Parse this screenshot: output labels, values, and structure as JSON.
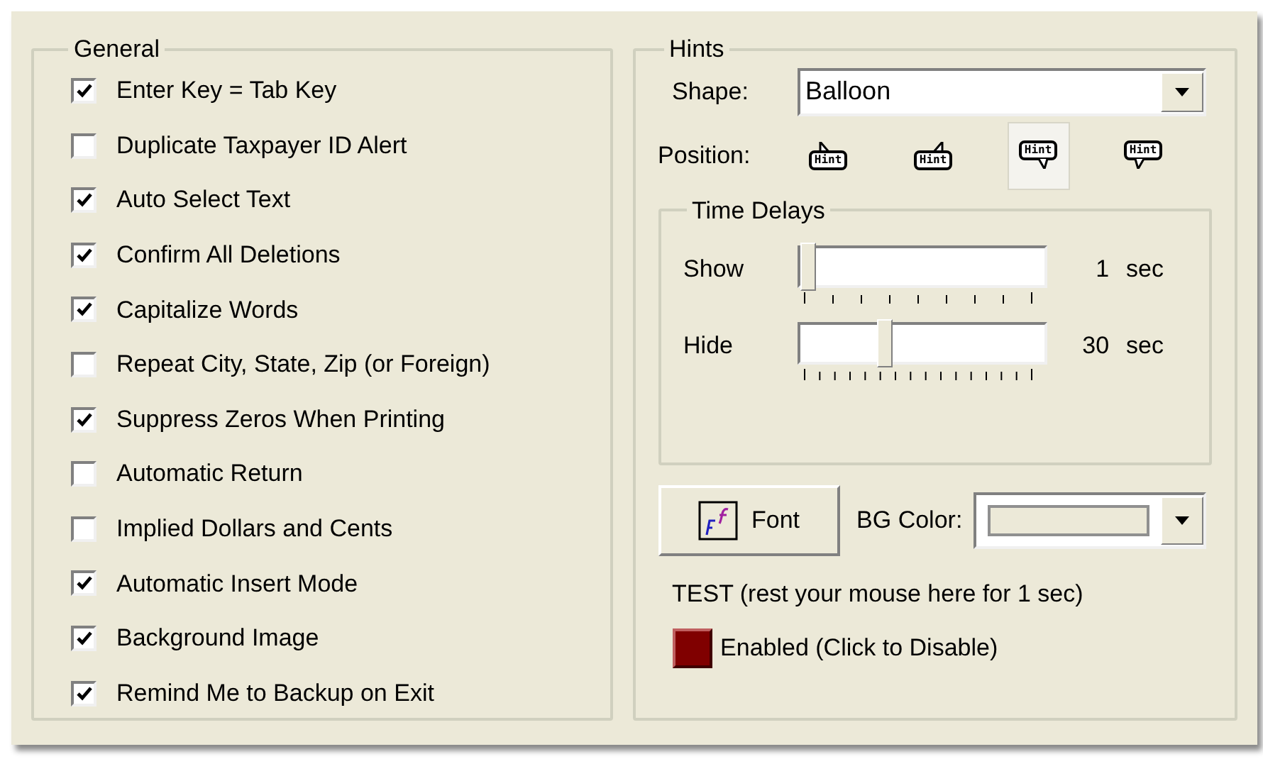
{
  "general": {
    "title": "General",
    "options": [
      {
        "label": "Enter Key = Tab Key",
        "checked": true
      },
      {
        "label": "Duplicate Taxpayer ID Alert",
        "checked": false
      },
      {
        "label": "Auto Select Text",
        "checked": true
      },
      {
        "label": "Confirm All Deletions",
        "checked": true
      },
      {
        "label": "Capitalize Words",
        "checked": true
      },
      {
        "label": "Repeat City, State, Zip (or Foreign)",
        "checked": false
      },
      {
        "label": "Suppress Zeros When Printing",
        "checked": true
      },
      {
        "label": "Automatic Return",
        "checked": false
      },
      {
        "label": "Implied Dollars and Cents",
        "checked": false
      },
      {
        "label": "Automatic Insert Mode",
        "checked": true
      },
      {
        "label": "Background Image",
        "checked": true
      },
      {
        "label": "Remind Me to Backup on Exit",
        "checked": true
      }
    ]
  },
  "hints": {
    "title": "Hints",
    "shape_label": "Shape:",
    "shape_value": "Balloon",
    "position_label": "Position:",
    "positions": [
      {
        "label": "Hint",
        "kind": "upleft",
        "selected": false
      },
      {
        "label": "Hint",
        "kind": "upright",
        "selected": false
      },
      {
        "label": "Hint",
        "kind": "downright",
        "selected": true
      },
      {
        "label": "Hint",
        "kind": "downleft",
        "selected": false
      }
    ],
    "time_delays": {
      "title": "Time Delays",
      "sliders": [
        {
          "label": "Show",
          "level": 0,
          "value": "1",
          "unit": "sec"
        },
        {
          "label": "Hide",
          "level": 0.34,
          "value": "30",
          "unit": "sec"
        }
      ]
    },
    "font_button": "Font",
    "bg_color_label": "BG Color:",
    "test_text": "TEST (rest your mouse here for 1 sec)",
    "toggle": {
      "label": "Enabled (Click to Disable)",
      "enabled": true
    }
  }
}
